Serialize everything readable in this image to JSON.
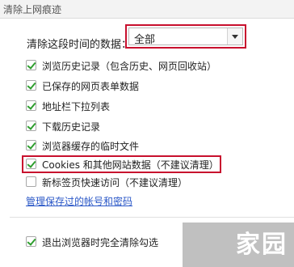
{
  "title": "清除上网痕迹",
  "time_range": {
    "label": "清除这段时间的数据：",
    "selected": "全部"
  },
  "options": [
    {
      "label": "浏览历史记录（包含历史、网页回收站）",
      "checked": true
    },
    {
      "label": "已保存的网页表单数据",
      "checked": true
    },
    {
      "label": "地址栏下拉列表",
      "checked": true
    },
    {
      "label": "下载历史记录",
      "checked": true
    },
    {
      "label": "浏览器缓存的临时文件",
      "checked": true
    },
    {
      "label": "Cookies 和其他网站数据（不建议清理）",
      "checked": true
    },
    {
      "label": "新标签页快速访问（不建议清理）",
      "checked": false
    }
  ],
  "manage_link": "管理保存过的帐号和密码",
  "exit_option": {
    "label": "退出浏览器时完全清除勾选",
    "checked": true
  },
  "watermark": "家园",
  "colors": {
    "highlight": "#c8102e",
    "link": "#2a57c7",
    "check": "#2e9e2e"
  }
}
